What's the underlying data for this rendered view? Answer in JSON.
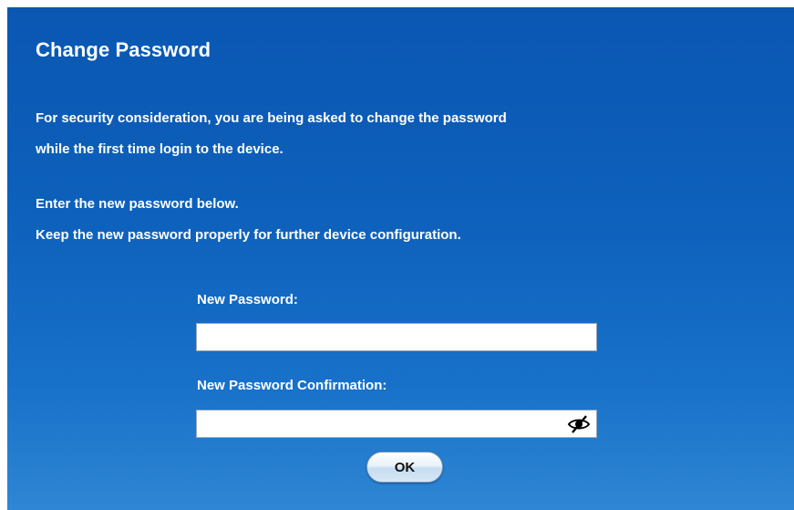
{
  "dialog": {
    "title": "Change Password",
    "intro_line1": "For security consideration, you are being asked to change the password",
    "intro_line2": "while the first time login to the device.",
    "instruction_line1": "Enter the new password below.",
    "instruction_line2": "Keep the new password properly for further device configuration."
  },
  "form": {
    "new_password_label": "New Password:",
    "new_password_value": "",
    "confirm_label": "New Password Confirmation:",
    "confirm_value": "",
    "show_password_icon": "eye-slash-icon",
    "ok_label": "OK"
  },
  "colors": {
    "panel_background": "#0d60bb",
    "text": "#ffffff"
  }
}
